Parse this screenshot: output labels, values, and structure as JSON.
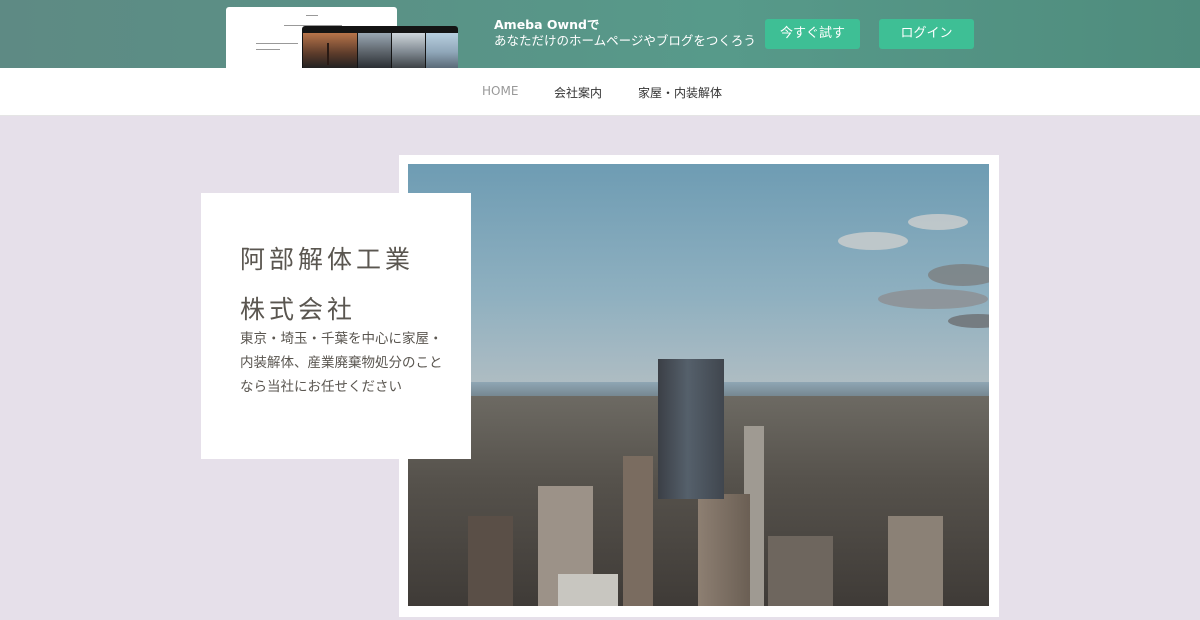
{
  "promo": {
    "line1": "Ameba Owndで",
    "line2": "あなただけのホームページやブログをつくろう",
    "try_label": "今すぐ試す",
    "login_label": "ログイン",
    "accent": "#3ebf95"
  },
  "nav": {
    "items": [
      {
        "label": "HOME",
        "active": true
      },
      {
        "label": "会社案内",
        "active": false
      },
      {
        "label": "家屋・内装解体",
        "active": false
      }
    ]
  },
  "hero": {
    "title_line1": "阿部解体工業",
    "title_line2": "株式会社",
    "description": "東京・埼玉・千葉を中心に家屋・内装解体、産業廃棄物処分のことなら当社にお任せください"
  },
  "colors": {
    "background": "#e6e0ea",
    "text": "#5a5650"
  }
}
